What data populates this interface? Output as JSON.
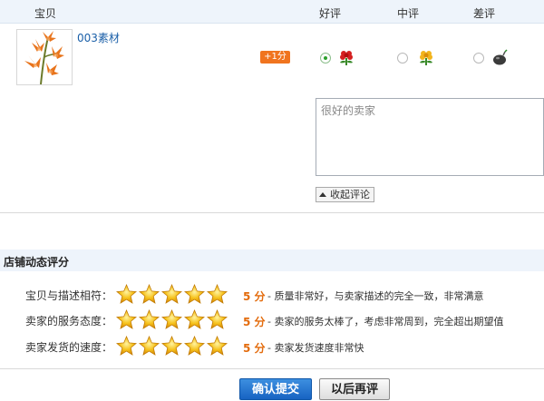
{
  "header": {
    "col_item": "宝贝",
    "col_good": "好评",
    "col_mid": "中评",
    "col_bad": "差评"
  },
  "item": {
    "title": "003素材",
    "score_badge": "+1分",
    "selected_rating": "good"
  },
  "comment": {
    "placeholder": "很好的卖家",
    "value": "很好的卖家",
    "collapse_label": "收起评论"
  },
  "shop_rating": {
    "title": "店铺动态评分",
    "rows": [
      {
        "label": "宝贝与描述相符：",
        "stars": 5,
        "score": "5 分",
        "desc": "- 质量非常好，与卖家描述的完全一致，非常满意"
      },
      {
        "label": "卖家的服务态度：",
        "stars": 5,
        "score": "5 分",
        "desc": "- 卖家的服务太棒了，考虑非常周到，完全超出期望值"
      },
      {
        "label": "卖家发货的速度：",
        "stars": 5,
        "score": "5 分",
        "desc": "- 卖家发货速度非常快"
      }
    ]
  },
  "buttons": {
    "submit": "确认提交",
    "later": "以后再评"
  },
  "colors": {
    "accent_blue": "#1763c2",
    "score_orange": "#e36b0c",
    "badge_orange": "#f0741f",
    "link_blue": "#1a5fa8"
  },
  "icons": {
    "good": "red-flower-icon",
    "mid": "yellow-flower-icon",
    "bad": "bomb-icon",
    "star": "gold-star-icon"
  }
}
